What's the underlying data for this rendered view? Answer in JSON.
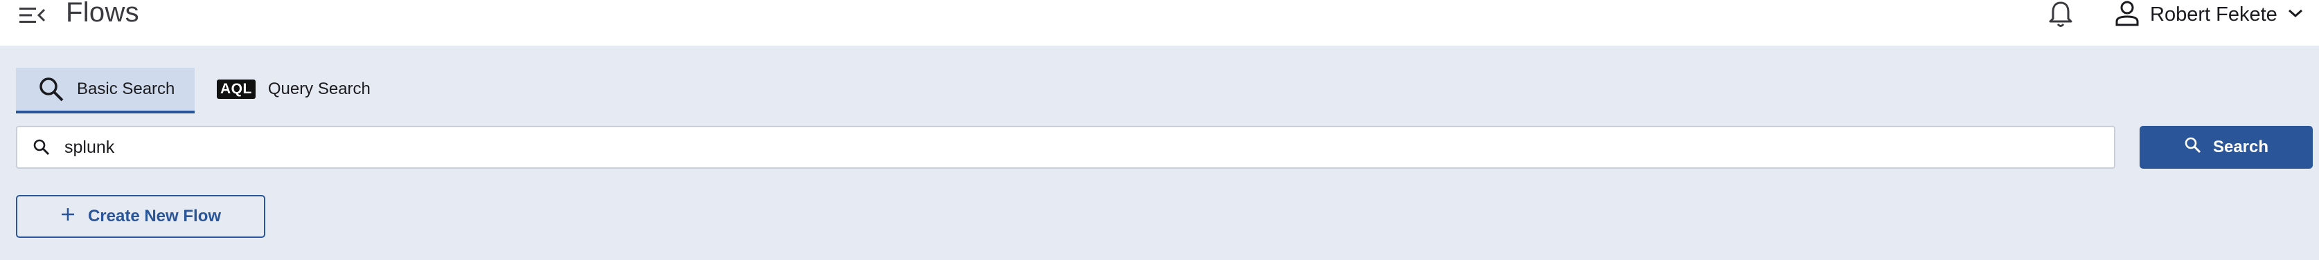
{
  "header": {
    "title": "Flows",
    "menu_icon": "menu-collapse-icon",
    "notification_icon": "bell-icon",
    "user": {
      "icon": "person-icon",
      "name": "Robert Fekete",
      "dropdown_icon": "chevron-down-icon"
    }
  },
  "tabs": [
    {
      "label": "Basic Search",
      "icon": "search-icon",
      "active": true
    },
    {
      "label": "Query Search",
      "badge": "AQL",
      "active": false
    }
  ],
  "search": {
    "value": "splunk",
    "placeholder": "",
    "icon": "search-icon",
    "button_label": "Search"
  },
  "actions": {
    "create_label": "Create New Flow",
    "create_icon": "plus-icon"
  },
  "colors": {
    "accent": "#2a5599",
    "background": "#e6ebf3",
    "active_tab": "#cfdbec"
  }
}
